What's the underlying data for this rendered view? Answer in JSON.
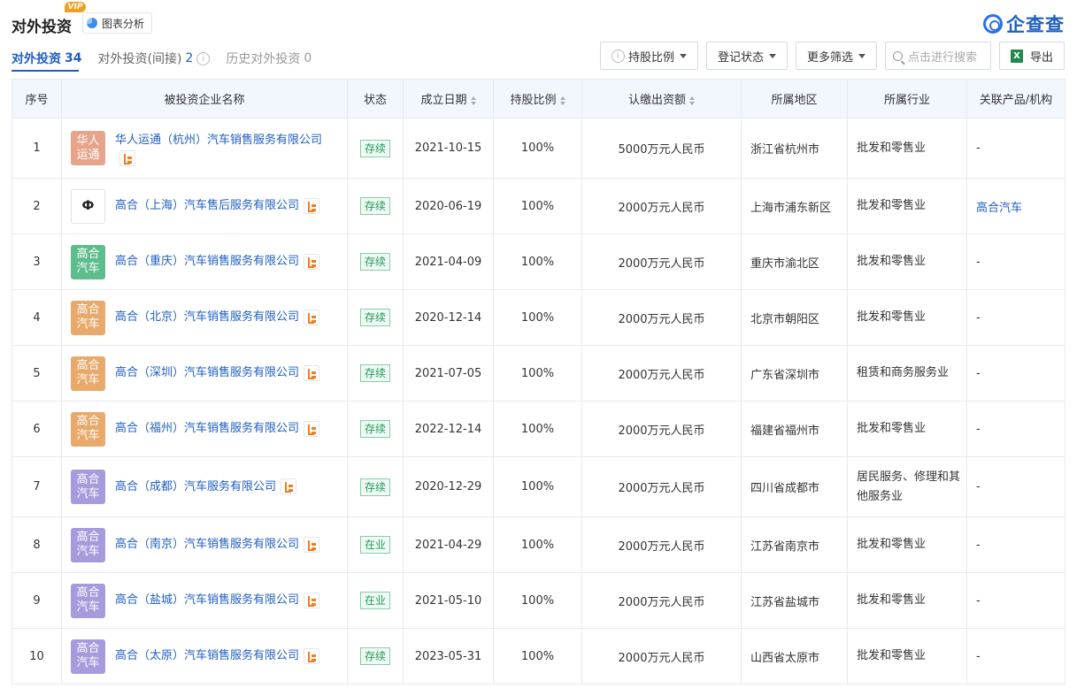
{
  "header": {
    "title": "对外投资",
    "vip": "VIP",
    "chart_button": "图表分析",
    "logo_text": "企查查"
  },
  "tabs": [
    {
      "label": "对外投资",
      "count": "34"
    },
    {
      "label": "对外投资(间接)",
      "count": "2"
    },
    {
      "label": "历史对外投资",
      "count": "0"
    }
  ],
  "toolbar": {
    "share_ratio": "持股比例",
    "reg_status": "登记状态",
    "more_filters": "更多筛选",
    "search_placeholder": "点击进行搜索",
    "export": "导出"
  },
  "columns": [
    "序号",
    "被投资企业名称",
    "状态",
    "成立日期",
    "持股比例",
    "认缴出资额",
    "所属地区",
    "所属行业",
    "关联产品/机构"
  ],
  "colors": {
    "orange_logo": "#e8a96b",
    "peach_logo": "#e6a48a",
    "green_logo": "#5dbd8c",
    "purple_logo": "#a79bdd",
    "link": "#1f5ec2"
  },
  "rows": [
    {
      "index": "1",
      "logo_text": "华人运通",
      "logo_color": "#e6a48a",
      "name": "华人运通（杭州）汽车销售服务有限公司",
      "status": "存续",
      "date": "2021-10-15",
      "ratio": "100%",
      "capital": "5000万元人民币",
      "region": "浙江省杭州市",
      "industry": "批发和零售业",
      "related": "-"
    },
    {
      "index": "2",
      "logo_text": "Ф",
      "logo_color": "#ffffff",
      "name": "高合（上海）汽车售后服务有限公司",
      "status": "存续",
      "date": "2020-06-19",
      "ratio": "100%",
      "capital": "2000万元人民币",
      "region": "上海市浦东新区",
      "industry": "批发和零售业",
      "related": "高合汽车"
    },
    {
      "index": "3",
      "logo_text": "高合汽车",
      "logo_color": "#5dbd8c",
      "name": "高合（重庆）汽车销售服务有限公司",
      "status": "存续",
      "date": "2021-04-09",
      "ratio": "100%",
      "capital": "2000万元人民币",
      "region": "重庆市渝北区",
      "industry": "批发和零售业",
      "related": "-"
    },
    {
      "index": "4",
      "logo_text": "高合汽车",
      "logo_color": "#e8a96b",
      "name": "高合（北京）汽车销售服务有限公司",
      "status": "存续",
      "date": "2020-12-14",
      "ratio": "100%",
      "capital": "2000万元人民币",
      "region": "北京市朝阳区",
      "industry": "批发和零售业",
      "related": "-"
    },
    {
      "index": "5",
      "logo_text": "高合汽车",
      "logo_color": "#e8a96b",
      "name": "高合（深圳）汽车销售服务有限公司",
      "status": "存续",
      "date": "2021-07-05",
      "ratio": "100%",
      "capital": "2000万元人民币",
      "region": "广东省深圳市",
      "industry": "租赁和商务服务业",
      "related": "-"
    },
    {
      "index": "6",
      "logo_text": "高合汽车",
      "logo_color": "#e8a96b",
      "name": "高合（福州）汽车销售服务有限公司",
      "status": "存续",
      "date": "2022-12-14",
      "ratio": "100%",
      "capital": "2000万元人民币",
      "region": "福建省福州市",
      "industry": "批发和零售业",
      "related": "-"
    },
    {
      "index": "7",
      "logo_text": "高合汽车",
      "logo_color": "#a79bdd",
      "name": "高合（成都）汽车服务有限公司",
      "status": "存续",
      "date": "2020-12-29",
      "ratio": "100%",
      "capital": "2000万元人民币",
      "region": "四川省成都市",
      "industry": "居民服务、修理和其他服务业",
      "related": "-"
    },
    {
      "index": "8",
      "logo_text": "高合汽车",
      "logo_color": "#a79bdd",
      "name": "高合（南京）汽车销售服务有限公司",
      "status": "在业",
      "date": "2021-04-29",
      "ratio": "100%",
      "capital": "2000万元人民币",
      "region": "江苏省南京市",
      "industry": "批发和零售业",
      "related": "-"
    },
    {
      "index": "9",
      "logo_text": "高合汽车",
      "logo_color": "#a79bdd",
      "name": "高合（盐城）汽车销售服务有限公司",
      "status": "在业",
      "date": "2021-05-10",
      "ratio": "100%",
      "capital": "2000万元人民币",
      "region": "江苏省盐城市",
      "industry": "批发和零售业",
      "related": "-"
    },
    {
      "index": "10",
      "logo_text": "高合汽车",
      "logo_color": "#a79bdd",
      "name": "高合（太原）汽车销售服务有限公司",
      "status": "存续",
      "date": "2023-05-31",
      "ratio": "100%",
      "capital": "2000万元人民币",
      "region": "山西省太原市",
      "industry": "批发和零售业",
      "related": "-"
    }
  ]
}
